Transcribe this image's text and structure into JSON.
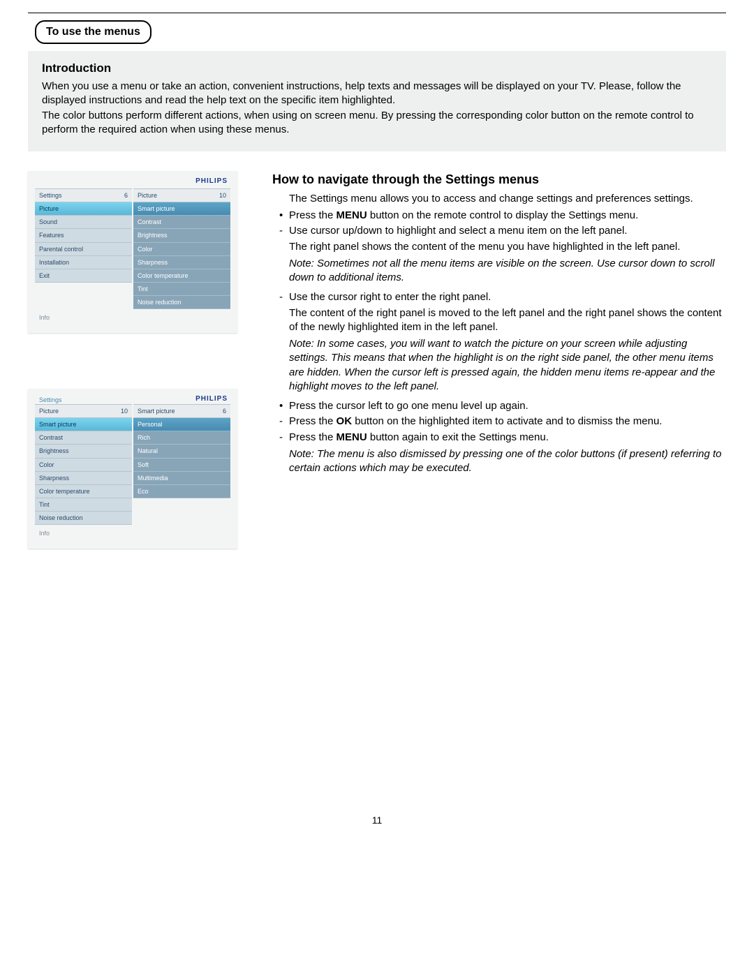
{
  "section_title": "To use the menus",
  "intro": {
    "heading": "Introduction",
    "p1": "When you use a menu or take an action, convenient instructions, help texts and messages will be displayed on your TV. Please, follow the displayed instructions and read the help text on the specific item highlighted.",
    "p2": "The color buttons perform different actions, when using on screen menu. By pressing the corresponding color button on the remote control to perform the required action when using these menus."
  },
  "howto": {
    "heading": "How to navigate through the Settings menus",
    "lead": "The Settings menu allows you to access and change settings and preferences settings.",
    "b1a": "Press the ",
    "b1b": "MENU",
    "b1c": " button on the remote control to display the Settings menu.",
    "d1": "Use cursor up/down to highlight and select a menu item on the left panel.",
    "c1": "The right panel shows the content of the menu you have highlighted in the left panel.",
    "n1": "Note: Sometimes not all the menu items are visible on the screen. Use cursor down to scroll down to additional items.",
    "d2": "Use the cursor right to enter the right panel.",
    "c2": "The content of the right panel is moved to the left panel and the right panel shows the content of the newly highlighted item in the left panel.",
    "n2": "Note: In some cases, you will want to watch the picture on your screen while adjusting settings. This means that when the highlight is on the right side panel, the other menu items are hidden. When the cursor left is pressed again, the hidden menu items re-appear and the highlight moves to the left panel.",
    "b2": "Press the cursor left to go one menu level up again.",
    "d3a": "Press the ",
    "d3b": "OK",
    "d3c": " button on the highlighted item to activate and to dismiss the menu.",
    "d4a": "Press the ",
    "d4b": "MENU",
    "d4c": " button again to exit the Settings menu.",
    "n3": "Note: The menu is also dismissed by pressing one of the color buttons (if present) referring to certain actions which may be executed."
  },
  "page_number": "11",
  "brand": "PHILIPS",
  "info_label": "Info",
  "menu1": {
    "left_header": "Settings",
    "left_count": "6",
    "right_header": "Picture",
    "right_count": "10",
    "left_items": [
      "Picture",
      "Sound",
      "Features",
      "Parental control",
      "Installation",
      "Exit"
    ],
    "right_items": [
      "Smart picture",
      "Contrast",
      "Brightness",
      "Color",
      "Sharpness",
      "Color temperature",
      "Tint",
      "Noise reduction"
    ]
  },
  "menu2": {
    "crumb": "Settings",
    "left_header": "Picture",
    "left_count": "10",
    "right_header": "Smart picture",
    "right_count": "6",
    "left_items": [
      "Smart picture",
      "Contrast",
      "Brightness",
      "Color",
      "Sharpness",
      "Color temperature",
      "Tint",
      "Noise reduction"
    ],
    "right_items": [
      "Personal",
      "Rich",
      "Natural",
      "Soft",
      "Multimedia",
      "Eco"
    ]
  }
}
